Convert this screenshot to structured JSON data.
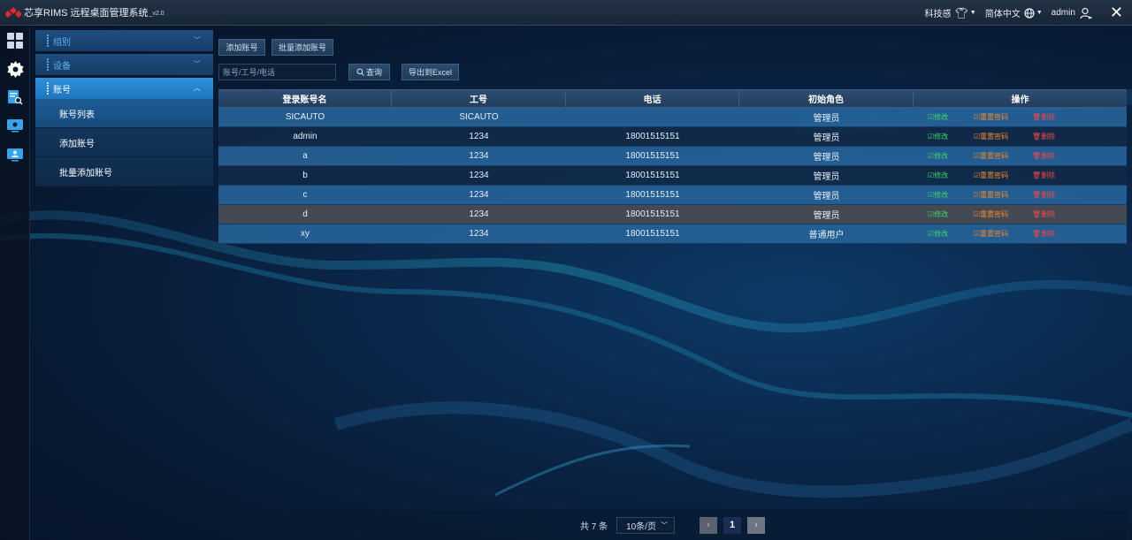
{
  "titlebar": {
    "app_title": "芯享RIMS 远程桌面管理系统",
    "version": "_v2.0",
    "theme_label": "科技感",
    "language_label": "简体中文",
    "username": "admin"
  },
  "rail": {
    "icons": [
      "dashboard-icon",
      "gear-icon",
      "search-doc-icon",
      "monitor-icon",
      "user-monitor-icon"
    ]
  },
  "sidebar": {
    "groups": [
      {
        "label": "组别"
      },
      {
        "label": "设备"
      },
      {
        "label": "账号"
      }
    ],
    "sub_items": [
      {
        "label": "账号列表"
      },
      {
        "label": "添加账号"
      },
      {
        "label": "批量添加账号"
      }
    ]
  },
  "toolbar": {
    "add_label": "添加账号",
    "batch_add_label": "批量添加账号",
    "search_placeholder": "账号/工号/电话",
    "query_label": "查询",
    "export_label": "导出到Excel"
  },
  "table": {
    "headers": [
      "登录账号名",
      "工号",
      "电话",
      "初始角色",
      "操作"
    ],
    "rows": [
      {
        "account": "SICAUTO",
        "id": "SICAUTO",
        "phone": "",
        "role": "管理员"
      },
      {
        "account": "admin",
        "id": "1234",
        "phone": "18001515151",
        "role": "管理员"
      },
      {
        "account": "a",
        "id": "1234",
        "phone": "18001515151",
        "role": "管理员"
      },
      {
        "account": "b",
        "id": "1234",
        "phone": "18001515151",
        "role": "管理员"
      },
      {
        "account": "c",
        "id": "1234",
        "phone": "18001515151",
        "role": "管理员"
      },
      {
        "account": "d",
        "id": "1234",
        "phone": "18001515151",
        "role": "管理员"
      },
      {
        "account": "xy",
        "id": "1234",
        "phone": "18001515151",
        "role": "普通用户"
      }
    ],
    "actions": {
      "edit": "修改",
      "reset": "重置密码",
      "delete": "删除"
    }
  },
  "pagination": {
    "total": "共 7 条",
    "page_size": "10条/页",
    "current_page": "1"
  },
  "colors": {
    "accent": "#2f8fd8",
    "edit": "#3fd36b",
    "reset": "#f0892a",
    "delete": "#ef4a4a"
  }
}
